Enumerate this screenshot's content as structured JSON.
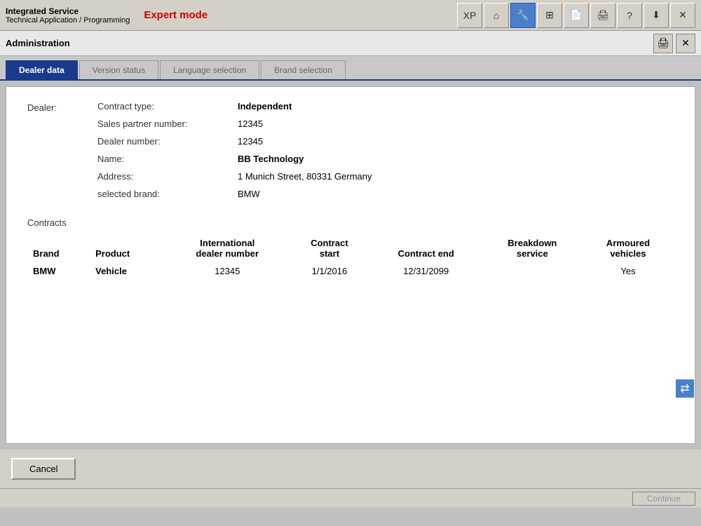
{
  "app": {
    "line1": "Integrated Service",
    "line2": "Technical Application / Programming",
    "expert_mode": "Expert mode"
  },
  "toolbar": {
    "buttons": [
      {
        "name": "xp-button",
        "label": "XP",
        "icon": "XP",
        "active": false
      },
      {
        "name": "home-button",
        "label": "Home",
        "icon": "⌂",
        "active": false
      },
      {
        "name": "wrench-button",
        "label": "Wrench",
        "icon": "🔧",
        "active": true
      },
      {
        "name": "grid-button",
        "label": "Grid",
        "icon": "▦",
        "active": false
      },
      {
        "name": "clipboard-button",
        "label": "Clipboard",
        "icon": "📋",
        "active": false
      },
      {
        "name": "print-button",
        "label": "Print",
        "icon": "🖨",
        "active": false
      },
      {
        "name": "help-button",
        "label": "Help",
        "icon": "?",
        "active": false
      },
      {
        "name": "download-button",
        "label": "Download",
        "icon": "⬇",
        "active": false
      },
      {
        "name": "close-button",
        "label": "Close",
        "icon": "✕",
        "active": false
      }
    ]
  },
  "admin_bar": {
    "title": "Administration",
    "icons": [
      {
        "name": "print-admin-icon",
        "symbol": "🖨"
      },
      {
        "name": "close-admin-icon",
        "symbol": "✕"
      }
    ]
  },
  "tabs": [
    {
      "name": "dealer-data-tab",
      "label": "Dealer data",
      "active": true
    },
    {
      "name": "version-status-tab",
      "label": "Version status",
      "active": false
    },
    {
      "name": "language-selection-tab",
      "label": "Language selection",
      "active": false
    },
    {
      "name": "brand-selection-tab",
      "label": "Brand selection",
      "active": false
    }
  ],
  "dealer": {
    "section_label": "Dealer:",
    "fields": [
      {
        "label": "Contract type:",
        "value": "Independent",
        "bold": true
      },
      {
        "label": "Sales partner number:",
        "value": "12345",
        "bold": false
      },
      {
        "label": "Dealer number:",
        "value": "12345",
        "bold": false
      },
      {
        "label": "Name:",
        "value": "BB Technology",
        "bold": true
      },
      {
        "label": "Address:",
        "value": "1 Munich Street, 80331 Germany",
        "bold": false
      },
      {
        "label": "selected brand:",
        "value": "BMW",
        "bold": false
      }
    ]
  },
  "contracts": {
    "label": "Contracts",
    "columns": [
      "Brand",
      "Product",
      "International\ndealer number",
      "Contract\nstart",
      "Contract end",
      "Breakdown\nservice",
      "Armoured\nvehicles"
    ],
    "col_labels": {
      "brand": "Brand",
      "product": "Product",
      "intl_dealer": "International dealer number",
      "contract_start": "Contract start",
      "contract_end": "Contract end",
      "breakdown": "Breakdown service",
      "armoured": "Armoured vehicles"
    },
    "rows": [
      {
        "brand": "BMW",
        "product": "Vehicle",
        "intl_dealer": "12345",
        "contract_start": "1/1/2016",
        "contract_end": "12/31/2099",
        "breakdown": "",
        "armoured": "Yes"
      }
    ]
  },
  "buttons": {
    "cancel": "Cancel",
    "continue": "Continue"
  },
  "side_arrow": "⇄"
}
